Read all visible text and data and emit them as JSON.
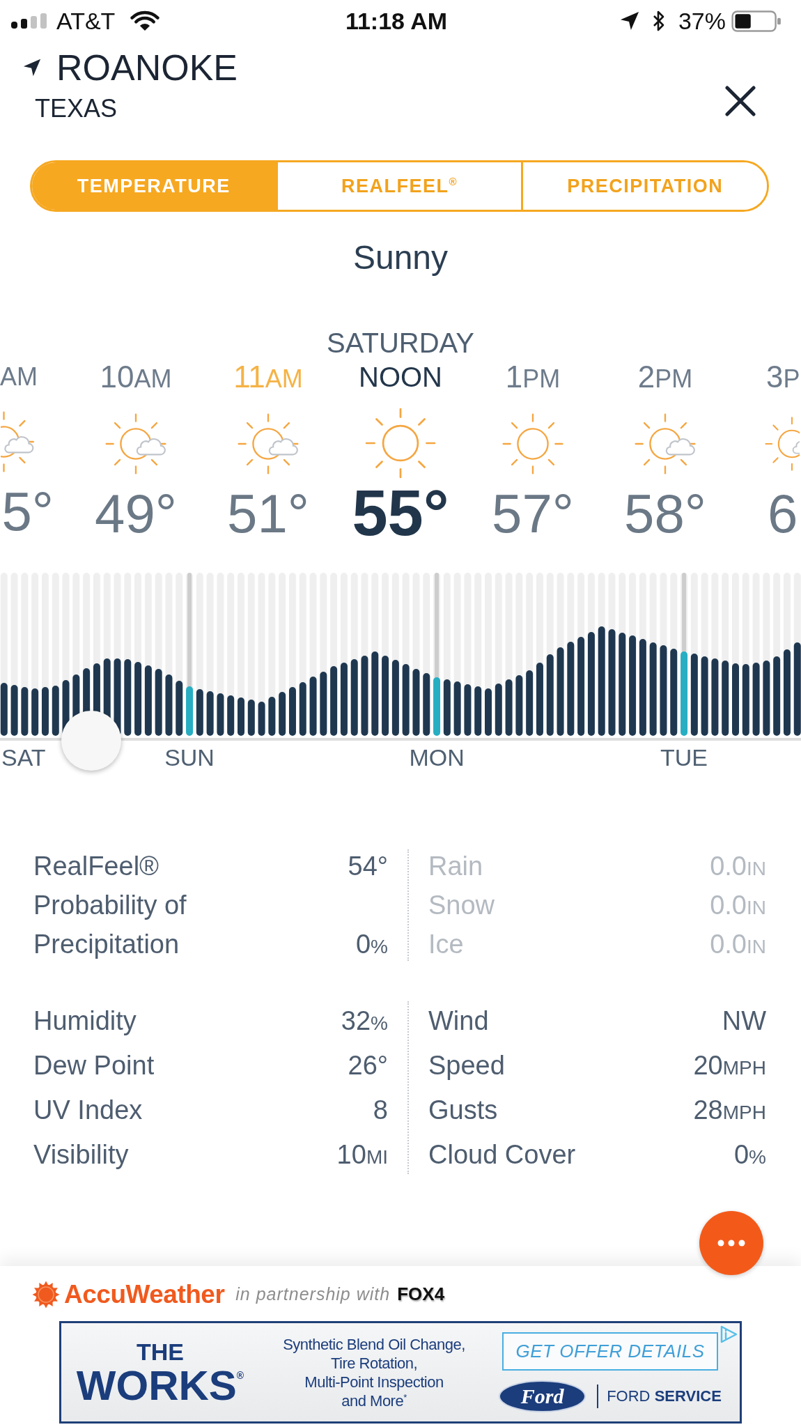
{
  "status_bar": {
    "carrier": "AT&T",
    "time": "11:18 AM",
    "battery": "37%"
  },
  "header": {
    "city": "ROANOKE",
    "region": "TEXAS"
  },
  "tabs": [
    {
      "label": "TEMPERATURE",
      "selected": true
    },
    {
      "label": "REALFEEL$^{®}$",
      "selected": false
    },
    {
      "label": "PRECIPITATION",
      "selected": false
    }
  ],
  "condition": "Sunny",
  "hours": [
    {
      "suffix": "AM",
      "kind": "partly-sunny",
      "temp": "5°",
      "selected": false,
      "current": false
    },
    {
      "hour": "10",
      "suffix": "AM",
      "kind": "partly-sunny",
      "temp": "49°",
      "selected": false,
      "current": false
    },
    {
      "hour": "11",
      "suffix": "AM",
      "kind": "partly-sunny",
      "temp": "51°",
      "selected": false,
      "current": true
    },
    {
      "day": "SATURDAY",
      "suffix": "NOON",
      "kind": "sunny",
      "temp": "55°",
      "selected": true,
      "current": false
    },
    {
      "hour": "1",
      "suffix": "PM",
      "kind": "sunny",
      "temp": "57°",
      "selected": false,
      "current": false
    },
    {
      "hour": "2",
      "suffix": "PM",
      "kind": "partly-sunny",
      "temp": "58°",
      "selected": false,
      "current": false
    },
    {
      "hour": "3",
      "suffix": "P",
      "kind": "partly-sunny",
      "temp": "6",
      "selected": false,
      "current": false
    }
  ],
  "timeline": {
    "days": [
      "SAT",
      "SUN",
      "MON",
      "TUE"
    ]
  },
  "details": [
    {
      "left": [
        {
          "label": "RealFeel®",
          "value": "54°",
          "dimmed": false
        },
        {
          "label": "Probability of Precipitation",
          "value": "0",
          "unit": "%",
          "dimmed": false
        }
      ],
      "right": [
        {
          "label": "Rain",
          "value": "0.0",
          "unit": "IN",
          "dimmed": true
        },
        {
          "label": "Snow",
          "value": "0.0",
          "unit": "IN",
          "dimmed": true
        },
        {
          "label": "Ice",
          "value": "0.0",
          "unit": "IN",
          "dimmed": true
        }
      ]
    },
    {
      "left": [
        {
          "label": "Humidity",
          "value": "32",
          "unit": "%",
          "dimmed": false
        },
        {
          "label": "Dew Point",
          "value": "26°",
          "dimmed": false
        },
        {
          "label": "UV Index",
          "value": "8",
          "dimmed": false
        },
        {
          "label": "Visibility",
          "value": "10",
          "unit": "MI",
          "dimmed": false
        }
      ],
      "right": [
        {
          "label": "Wind",
          "value": "NW",
          "dimmed": false
        },
        {
          "label": "Speed",
          "value": "20",
          "unit": "MPH",
          "dimmed": false
        },
        {
          "label": "Gusts",
          "value": "28",
          "unit": "MPH",
          "dimmed": false
        },
        {
          "label": "Cloud Cover",
          "value": "0",
          "unit": "%",
          "dimmed": false
        }
      ]
    }
  ],
  "footer": {
    "brand": "AccuWeather",
    "tagline": "in partnership with",
    "partner": "FOX4"
  },
  "ad": {
    "kicker": "THE",
    "headline": "WORKS$^{®}$",
    "offer": "Synthetic Blend Oil Change,\nTire Rotation,\nMulti-Point Inspection\nand More$^{*}$",
    "cta": "GET OFFER DETAILS",
    "logo": "Ford",
    "service": "FORD **SERVICE**"
  }
}
